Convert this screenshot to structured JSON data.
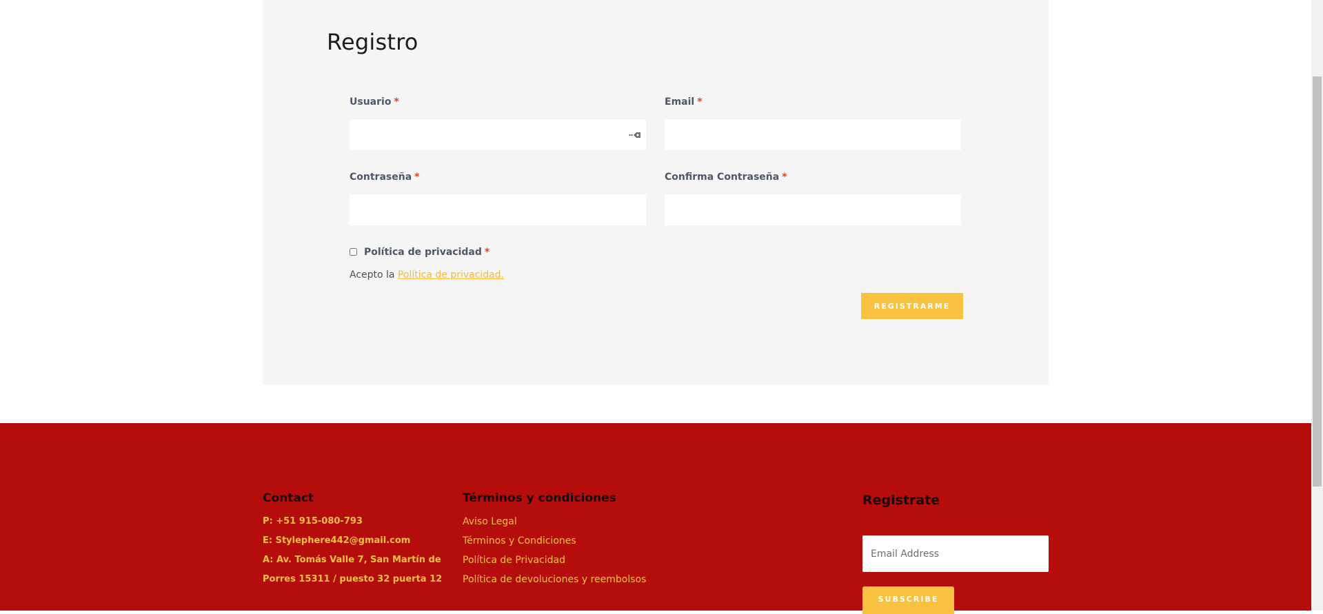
{
  "registration": {
    "title": "Registro",
    "fields": {
      "username_label": "Usuario",
      "email_label": "Email",
      "password_label": "Contraseña",
      "confirm_password_label": "Confirma Contraseña",
      "required_marker": "*"
    },
    "privacy": {
      "checkbox_label": "Política de privacidad",
      "accept_prefix": "Acepto la",
      "policy_link": "Política de privacidad."
    },
    "submit_label": "REGISTRARME"
  },
  "footer": {
    "contact": {
      "heading": "Contact",
      "phone": "P: +51 915-080-793",
      "email": "E: Stylephere442@gmail.com",
      "address_line1": "A: Av. Tomás Valle 7, San Martín de",
      "address_line2": "Porres 15311 / puesto 32 puerta 12"
    },
    "terms": {
      "heading": "Términos y condiciones",
      "links": [
        "Aviso Legal",
        "Términos y Condiciones",
        "Política de Privacidad",
        "Política de devoluciones y reembolsos"
      ]
    },
    "newsletter": {
      "heading": "Registrate",
      "email_placeholder": "Email Address",
      "subscribe_label": "SUBSCRIBE"
    }
  },
  "colors": {
    "accent": "#f8c240",
    "footer_bg": "#b50c0c",
    "panel_bg": "#f6f5f3",
    "required": "#e2401c"
  }
}
